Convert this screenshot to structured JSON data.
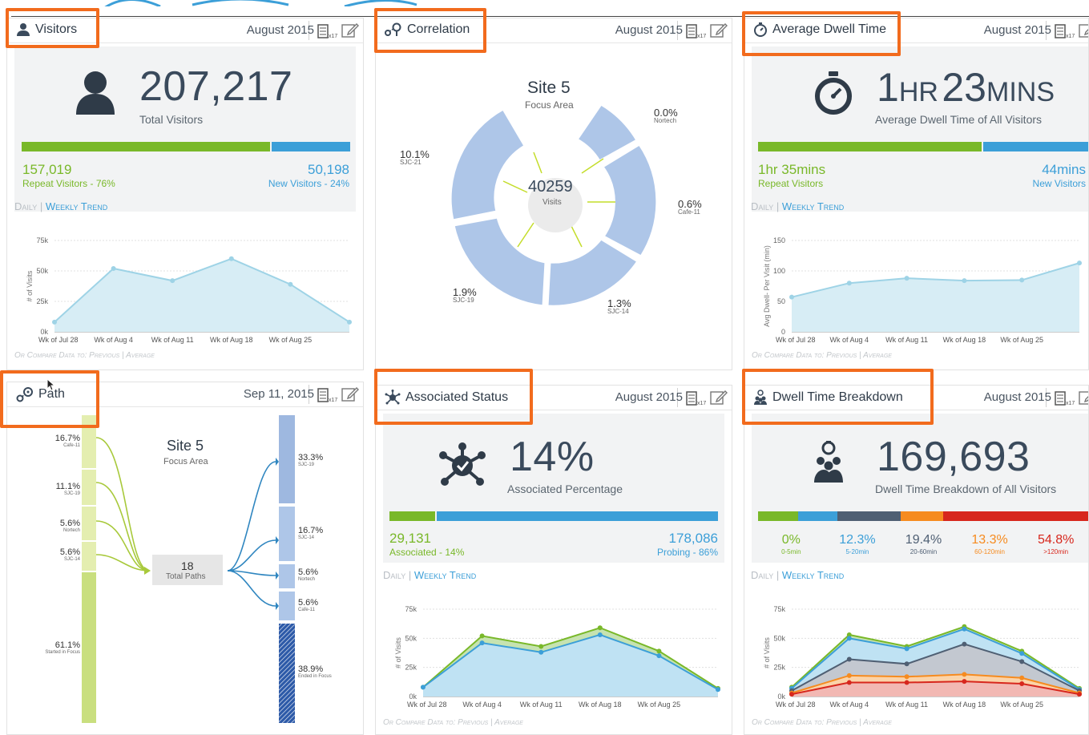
{
  "colors": {
    "green": "#79b829",
    "blue": "#3c9fd8",
    "highlight": "#f26b1d",
    "dark": "#3a4a5c"
  },
  "visitors": {
    "title": "Visitors",
    "date": "August 2015",
    "cal_badge": "x17",
    "total": "207,217",
    "total_label": "Total Visitors",
    "repeat_value": "157,019",
    "repeat_label": "Repeat Visitors - 76%",
    "new_value": "50,198",
    "new_label": "New Visitors - 24%",
    "split": [
      0.76,
      0.24
    ],
    "tab_daily": "Daily",
    "tab_weekly": "Weekly Trend",
    "compare": "Or Compare Data to: Previous | Average",
    "chart_data": {
      "type": "area",
      "categories": [
        "Wk of Jul 28",
        "Wk of Aug 4",
        "Wk of Aug 11",
        "Wk of Aug 18",
        "Wk of Aug 25"
      ],
      "x": [
        0,
        1.0,
        2.0,
        3.0,
        4.0,
        5.0
      ],
      "values": [
        8000,
        52000,
        42000,
        60000,
        39000,
        8000
      ],
      "ylim": [
        0,
        75000
      ],
      "yticks": [
        "0k",
        "25k",
        "50k",
        "75k"
      ],
      "ylabel": "# of Visits"
    }
  },
  "correlation": {
    "title": "Correlation",
    "date": "August 2015",
    "cal_badge": "x17",
    "site": "Site 5",
    "site_sub": "Focus Area",
    "center_value": "40259",
    "center_label": "Visits",
    "slices": [
      {
        "pct": "0.0%",
        "name": "Nortech"
      },
      {
        "pct": "0.6%",
        "name": "Cafe-11"
      },
      {
        "pct": "1.3%",
        "name": "SJC-14"
      },
      {
        "pct": "1.9%",
        "name": "SJC-19"
      },
      {
        "pct": "10.1%",
        "name": "SJC-21"
      }
    ]
  },
  "dwell": {
    "title": "Average Dwell Time",
    "date": "August 2015",
    "cal_badge": "x17",
    "big_num1": "1",
    "big_unit1": "HR",
    "big_num2": "23",
    "big_unit2": "MINS",
    "sub": "Average Dwell Time of All Visitors",
    "repeat_value": "1hr 35mins",
    "repeat_label": "Repeat Visitors",
    "new_value": "44mins",
    "new_label": "New Visitors",
    "split": [
      0.76,
      0.24
    ],
    "tab_daily": "Daily",
    "tab_weekly": "Weekly Trend",
    "compare": "Or Compare Data to: Previous | Average",
    "chart_data": {
      "type": "area",
      "categories": [
        "Wk of Jul 28",
        "Wk of Aug 4",
        "Wk of Aug 11",
        "Wk of Aug 18",
        "Wk of Aug 25"
      ],
      "x": [
        0,
        1.0,
        2.0,
        3.0,
        4.0,
        5.0
      ],
      "values": [
        57,
        80,
        88,
        84,
        85,
        113
      ],
      "ylim": [
        0,
        150
      ],
      "yticks": [
        "0",
        "50",
        "100",
        "150"
      ],
      "ylabel": "Avg Dwell- Per Visit (min)"
    }
  },
  "path": {
    "title": "Path",
    "date": "Sep 11, 2015",
    "cal_badge": "x17",
    "site": "Site 5",
    "site_sub": "Focus Area",
    "center_value": "18",
    "center_label": "Total Paths",
    "left": [
      {
        "pct": "16.7%",
        "name": "Cafe-11"
      },
      {
        "pct": "11.1%",
        "name": "SJC-19"
      },
      {
        "pct": "5.6%",
        "name": "Nortech"
      },
      {
        "pct": "5.6%",
        "name": "SJC-14"
      },
      {
        "pct": "61.1%",
        "name": "Started in Focus"
      }
    ],
    "right": [
      {
        "pct": "33.3%",
        "name": "SJC-19"
      },
      {
        "pct": "16.7%",
        "name": "SJC-14"
      },
      {
        "pct": "5.6%",
        "name": "Nortech"
      },
      {
        "pct": "5.6%",
        "name": "Cafe-11"
      },
      {
        "pct": "38.9%",
        "name": "Ended in Focus"
      }
    ]
  },
  "associated": {
    "title": "Associated Status",
    "date": "August 2015",
    "cal_badge": "x17",
    "big": "14%",
    "sub": "Associated Percentage",
    "assoc_value": "29,131",
    "assoc_label": "Associated - 14%",
    "probe_value": "178,086",
    "probe_label": "Probing - 86%",
    "split": [
      0.14,
      0.86
    ],
    "tab_daily": "Daily",
    "tab_weekly": "Weekly Trend",
    "compare": "Or Compare Data to: Previous | Average",
    "chart_data": {
      "type": "area",
      "categories": [
        "Wk of Jul 28",
        "Wk of Aug 4",
        "Wk of Aug 11",
        "Wk of Aug 18",
        "Wk of Aug 25"
      ],
      "x": [
        0,
        1.0,
        2.0,
        3.0,
        4.0,
        5.0
      ],
      "series": [
        {
          "name": "",
          "values": [
            8000,
            52000,
            43000,
            59000,
            39000,
            7000
          ],
          "color": "#79b829"
        },
        {
          "name": "",
          "values": [
            8000,
            46000,
            38000,
            53000,
            35000,
            6000
          ],
          "color": "#3c9fd8"
        }
      ],
      "ylim": [
        0,
        75000
      ],
      "yticks": [
        "0k",
        "25k",
        "50k",
        "75k"
      ],
      "ylabel": "# of Visits"
    }
  },
  "breakdown": {
    "title": "Dwell Time Breakdown",
    "date": "August 2015",
    "cal_badge": "x17",
    "big": "169,693",
    "sub": "Dwell Time Breakdown of All Visitors",
    "segments": [
      {
        "pct": "0%",
        "range": "0-5min",
        "color": "#79b829",
        "width": 0.12
      },
      {
        "pct": "12.3%",
        "range": "5-20min",
        "color": "#3c9fd8",
        "width": 0.12
      },
      {
        "pct": "19.4%",
        "range": "20-60min",
        "color": "#4f5f73",
        "width": 0.19
      },
      {
        "pct": "13.3%",
        "range": "60-120min",
        "color": "#f68b1f",
        "width": 0.13
      },
      {
        "pct": "54.8%",
        "range": ">120min",
        "color": "#d7271d",
        "width": 0.44
      }
    ],
    "tab_daily": "Daily",
    "tab_weekly": "Weekly Trend",
    "compare": "Or Compare Data to: Previous | Average",
    "chart_data": {
      "type": "area",
      "categories": [
        "Wk of Jul 28",
        "Wk of Aug 4",
        "Wk of Aug 11",
        "Wk of Aug 18",
        "Wk of Aug 25"
      ],
      "x": [
        0,
        1.0,
        2.0,
        3.0,
        4.0,
        5.0
      ],
      "series": [
        {
          "name": "",
          "values": [
            8000,
            53000,
            43000,
            60000,
            39000,
            7000
          ],
          "color": "#79b829"
        },
        {
          "name": "",
          "values": [
            7000,
            50000,
            41000,
            58000,
            37000,
            6000
          ],
          "color": "#3c9fd8"
        },
        {
          "name": "",
          "values": [
            5000,
            32000,
            28000,
            45000,
            30000,
            5000
          ],
          "color": "#4f5f73"
        },
        {
          "name": "",
          "values": [
            3000,
            18000,
            17000,
            19000,
            16000,
            3000
          ],
          "color": "#f68b1f"
        },
        {
          "name": "",
          "values": [
            2000,
            12000,
            12000,
            13000,
            11000,
            2000
          ],
          "color": "#d7271d"
        }
      ],
      "ylim": [
        0,
        75000
      ],
      "yticks": [
        "0k",
        "25k",
        "50k",
        "75k"
      ],
      "ylabel": "# of Visits"
    }
  }
}
